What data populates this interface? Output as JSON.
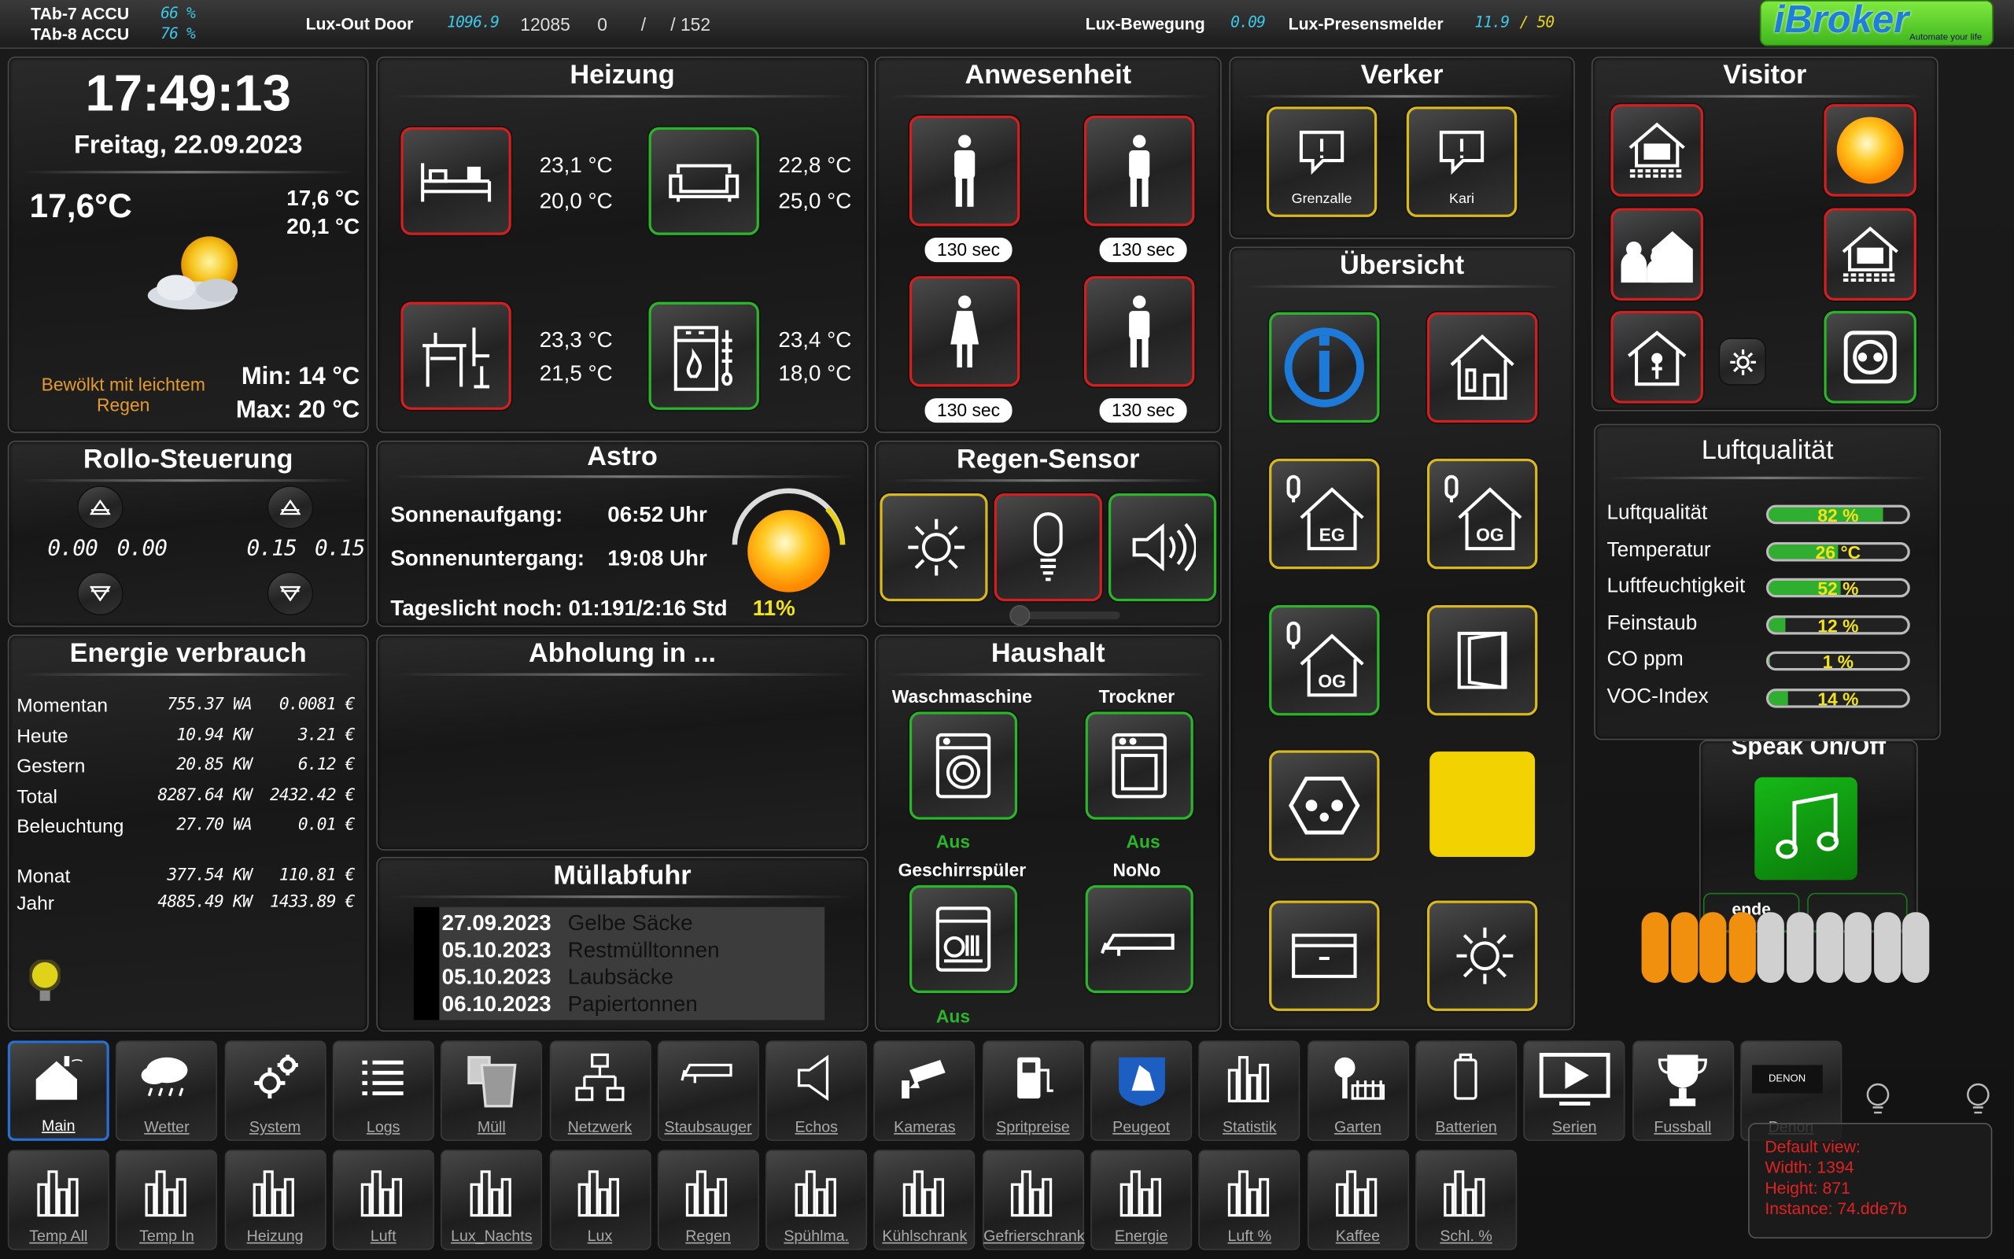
{
  "topbar": {
    "tab7": "TAb-7 ACCU",
    "tab7_val": "66 %",
    "tab8": "TAb-8 ACCU",
    "tab8_val": "76 %",
    "luxout_label": "Lux-Out Door",
    "luxout_val": "1096.9",
    "luxout_a": "12085",
    "luxout_b": "0",
    "luxout_sep": "/",
    "luxout_c": "/ 152",
    "luxbew_label": "Lux-Bewegung",
    "luxbew_val": "0.09",
    "luxpres_label": "Lux-Presensmelder",
    "luxpres_val": "11.9",
    "luxpres_max": "/ 50",
    "logo": "iBroker",
    "logo_sub": "Automate your life"
  },
  "clock": {
    "time": "17:49:13",
    "date": "Freitag, 22.09.2023",
    "temp": "17,6°C",
    "temp_in": "17,6 °C",
    "temp_in2": "20,1 °C",
    "condition": "Bewölkt mit leichtem Regen",
    "min": "Min: 14 °C",
    "max": "Max: 20 °C"
  },
  "heizung": {
    "title": "Heizung",
    "r1": {
      "a": "23,1 °C",
      "b": "20,0 °C"
    },
    "r2": {
      "a": "22,8 °C",
      "b": "25,0 °C"
    },
    "r3": {
      "a": "23,3 °C",
      "b": "21,5 °C"
    },
    "r4": {
      "a": "23,4 °C",
      "b": "18,0 °C"
    }
  },
  "anwesenheit": {
    "title": "Anwesenheit",
    "p1": "130 sec",
    "p2": "130 sec",
    "p3": "130 sec",
    "p4": "130 sec"
  },
  "verker": {
    "title": "Verker",
    "b1": "Grenzalle",
    "b2": "Kari"
  },
  "visitor": {
    "title": "Visitor"
  },
  "uebersicht": {
    "title": "Übersicht",
    "eg": "EG",
    "og1": "OG",
    "og2": "OG"
  },
  "luft": {
    "title": "Luftqualität",
    "rows": [
      {
        "label": "Luftqualität",
        "value": "82 %",
        "pct": 0.82
      },
      {
        "label": "Temperatur",
        "value": "26 °C",
        "pct": 0.5
      },
      {
        "label": "Luftfeuchtigkeit",
        "value": "52 %",
        "pct": 0.52
      },
      {
        "label": "Feinstaub",
        "value": "12 %",
        "pct": 0.12
      },
      {
        "label": "CO ppm",
        "value": "1 %",
        "pct": 0.01
      },
      {
        "label": "VOC-Index",
        "value": "14 %",
        "pct": 0.14
      }
    ]
  },
  "speak": {
    "title": "Speak On/Off",
    "ende": "ende",
    "vol_active": 4,
    "vol_total": 10
  },
  "rollo": {
    "title": "Rollo-Steuerung",
    "v1": "0.00",
    "v2": "0.00",
    "v3": "0.15",
    "v4": "0.15"
  },
  "astro": {
    "title": "Astro",
    "sa_label": "Sonnenaufgang:",
    "sa_val": "06:52 Uhr",
    "su_label": "Sonnenuntergang:",
    "su_val": "19:08 Uhr",
    "tag": "Tageslicht noch: 01:191/2:16 Std",
    "pct": "11%"
  },
  "regen": {
    "title": "Regen-Sensor"
  },
  "energie": {
    "title": "Energie verbrauch",
    "rows": [
      {
        "l": "Momentan",
        "a": "755.37 WA",
        "b": "0.0081 €"
      },
      {
        "l": "Heute",
        "a": "10.94 KW",
        "b": "3.21 €"
      },
      {
        "l": "Gestern",
        "a": "20.85 KW",
        "b": "6.12 €"
      },
      {
        "l": "Total",
        "a": "8287.64 KW",
        "b": "2432.42 €"
      },
      {
        "l": "Beleuchtung",
        "a": "27.70 WA",
        "b": "0.01 €"
      }
    ],
    "rows2": [
      {
        "l": "Monat",
        "a": "377.54 KW",
        "b": "110.81 €"
      },
      {
        "l": "Jahr",
        "a": "4885.49 KW",
        "b": "1433.89 €"
      }
    ]
  },
  "abholung": {
    "title": "Abholung in ..."
  },
  "muell": {
    "title": "Müllabfuhr",
    "items": [
      {
        "d": "27.09.2023",
        "t": "Gelbe Säcke"
      },
      {
        "d": "05.10.2023",
        "t": "Restmülltonnen"
      },
      {
        "d": "05.10.2023",
        "t": "Laubsäcke"
      },
      {
        "d": "06.10.2023",
        "t": "Papiertonnen"
      }
    ]
  },
  "haushalt": {
    "title": "Haushalt",
    "wm": "Waschmaschine",
    "wm_s": "Aus",
    "tr": "Trockner",
    "tr_s": "Aus",
    "gs": "Geschirrspüler",
    "gs_s": "Aus",
    "nono": "NoNo"
  },
  "nav1": [
    "Main",
    "Wetter",
    "System",
    "Logs",
    "Müll",
    "Netzwerk",
    "Staubsauger",
    "Echos",
    "Kameras",
    "Spritpreise",
    "Peugeot",
    "Statistik",
    "Garten",
    "Batterien",
    "Serien",
    "Fussball",
    "Denon"
  ],
  "nav2": [
    "Temp All",
    "Temp In",
    "Heizung",
    "Luft",
    "Lux_Nachts",
    "Lux",
    "Regen",
    "Spühlma.",
    "Kühlschrank",
    "Gefrierschrank",
    "Energie",
    "Luft %",
    "Kaffee",
    "Schl. %"
  ],
  "denon_logo": "DENON",
  "info": {
    "l1": "Default view:",
    "l2": "Width: 1394",
    "l3": "Height: 871",
    "l4": "Instance: 74.dde7b"
  }
}
